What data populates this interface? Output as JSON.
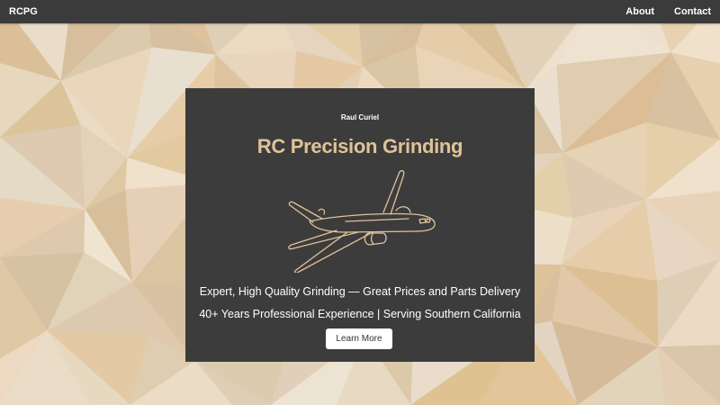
{
  "navbar": {
    "brand": "RCPG",
    "links": [
      {
        "label": "About"
      },
      {
        "label": "Contact"
      }
    ]
  },
  "hero": {
    "owner": "Raul Curiel",
    "title": "RC Precision Grinding",
    "icon": "airplane-icon",
    "tagline_1": "Expert, High Quality Grinding — Great Prices and Parts Delivery",
    "tagline_2": "40+ Years Professional Experience | Serving Southern California",
    "cta_label": "Learn More"
  },
  "colors": {
    "navbar_bg": "#3b3b3b",
    "card_bg": "#3d3c3c",
    "accent": "#dfc39a",
    "background_base": "#dcc7a8"
  }
}
